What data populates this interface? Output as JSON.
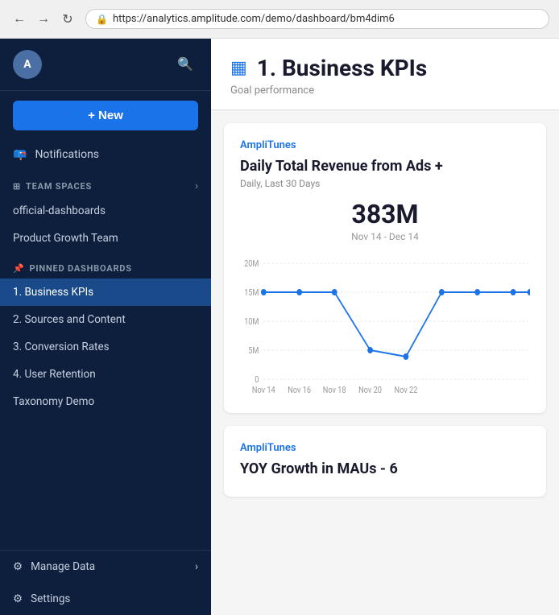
{
  "browser": {
    "url": "https://analytics.amplitude.com/demo/dashboard/bm4dim6"
  },
  "sidebar": {
    "avatar_initials": "A",
    "new_button_label": "+ New",
    "notifications_label": "Notifications",
    "team_spaces_label": "TEAM SPACES",
    "team_spaces_links": [
      {
        "id": "official-dashboards",
        "label": "official-dashboards"
      },
      {
        "id": "product-growth-team",
        "label": "Product Growth Team"
      }
    ],
    "pinned_dashboards_label": "PINNED DASHBOARDS",
    "pinned_items": [
      {
        "id": "business-kpis",
        "label": "1. Business KPIs",
        "active": true
      },
      {
        "id": "sources-content",
        "label": "2. Sources and Content",
        "active": false
      },
      {
        "id": "conversion-rates",
        "label": "3. Conversion Rates",
        "active": false
      },
      {
        "id": "user-retention",
        "label": "4. User Retention",
        "active": false
      },
      {
        "id": "taxonomy-demo",
        "label": "Taxonomy Demo",
        "active": false
      }
    ],
    "bottom_items": [
      {
        "id": "manage-data",
        "label": "Manage Data"
      },
      {
        "id": "settings",
        "label": "Settings"
      }
    ]
  },
  "main": {
    "page_title": "1. Business KPIs",
    "page_subtitle": "Goal performance",
    "cards": [
      {
        "id": "card-1",
        "brand": "AmpliTunes",
        "title": "Daily Total Revenue from Ads +",
        "subtitle": "Daily, Last 30 Days",
        "value": "383M",
        "range": "Nov 14 - Dec 14",
        "chart": {
          "y_labels": [
            "20M",
            "15M",
            "10M",
            "5M",
            "0"
          ],
          "x_labels": [
            "Nov 14",
            "Nov 16",
            "Nov 18",
            "Nov 20",
            "Nov 22"
          ],
          "data_points": [
            {
              "x": 0,
              "y": 1
            },
            {
              "x": 1,
              "y": 1
            },
            {
              "x": 2,
              "y": 1
            },
            {
              "x": 3,
              "y": 0.28
            },
            {
              "x": 4,
              "y": 0.3
            },
            {
              "x": 5,
              "y": 1
            },
            {
              "x": 6,
              "y": 1
            },
            {
              "x": 7,
              "y": 1
            },
            {
              "x": 8,
              "y": 1
            }
          ]
        }
      },
      {
        "id": "card-2",
        "brand": "AmpliTunes",
        "title": "YOY Growth in MAUs - 6",
        "subtitle": "",
        "value": "",
        "range": ""
      }
    ]
  }
}
